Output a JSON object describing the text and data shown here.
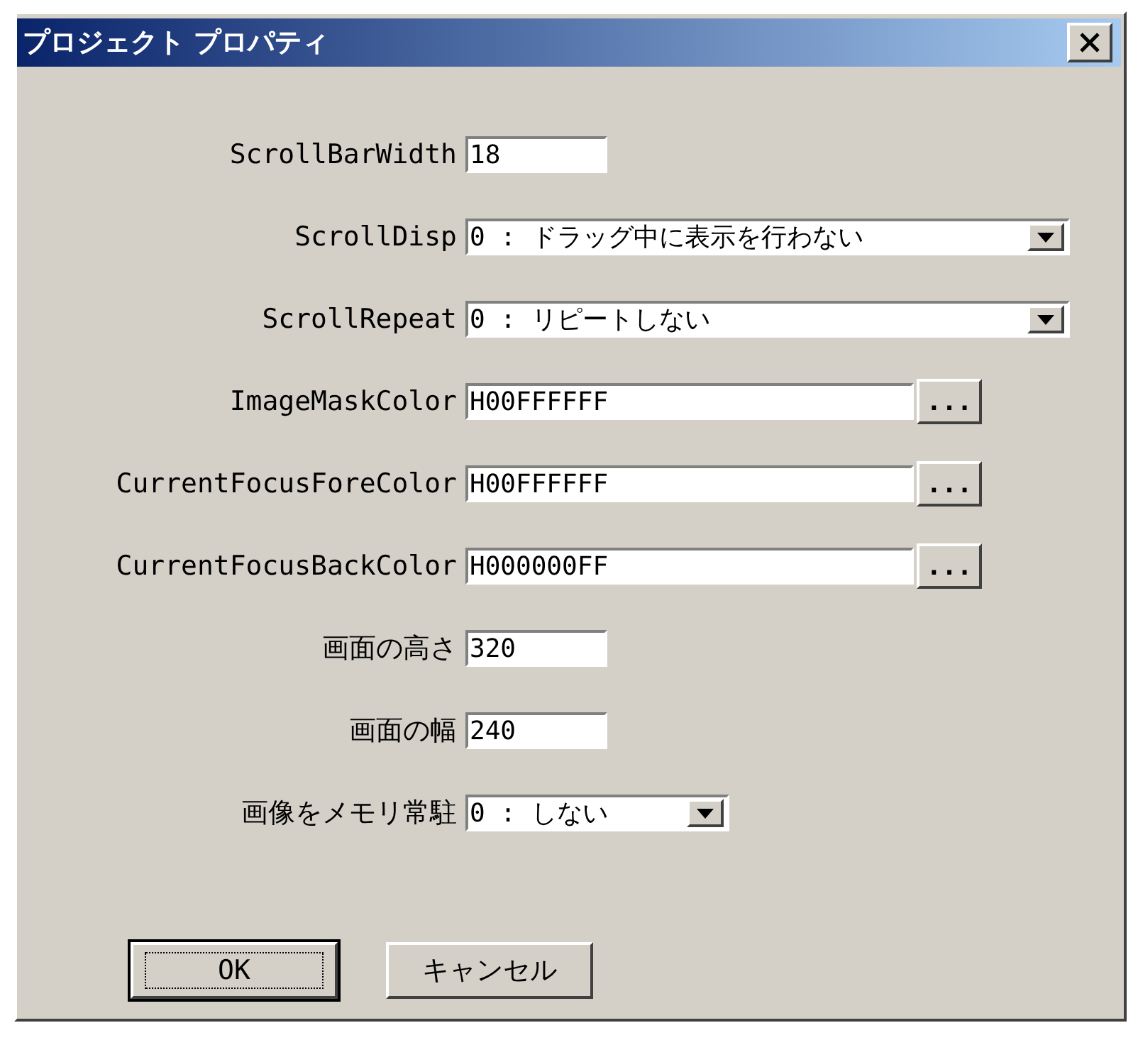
{
  "window": {
    "title": "プロジェクト プロパティ"
  },
  "fields": [
    {
      "label": "ScrollBarWidth",
      "kind": "short-text",
      "value": "18"
    },
    {
      "label": "ScrollDisp",
      "kind": "wide-dropdown",
      "value": "0 : ドラッグ中に表示を行わない"
    },
    {
      "label": "ScrollRepeat",
      "kind": "wide-dropdown",
      "value": "0 : リピートしない"
    },
    {
      "label": "ImageMaskColor",
      "kind": "color-text",
      "value": "H00FFFFFF",
      "button": "..."
    },
    {
      "label": "CurrentFocusForeColor",
      "kind": "color-text",
      "value": "H00FFFFFF",
      "button": "..."
    },
    {
      "label": "CurrentFocusBackColor",
      "kind": "color-text",
      "value": "H000000FF",
      "button": "..."
    },
    {
      "label": "画面の高さ",
      "kind": "short-text",
      "value": "320"
    },
    {
      "label": "画面の幅",
      "kind": "short-text",
      "value": "240"
    },
    {
      "label": "画像をメモリ常駐",
      "kind": "short-dropdown",
      "value": "0 : しない"
    }
  ],
  "buttons": [
    {
      "label": "OK",
      "focused": true
    },
    {
      "label": "キャンセル",
      "focused": false
    }
  ]
}
